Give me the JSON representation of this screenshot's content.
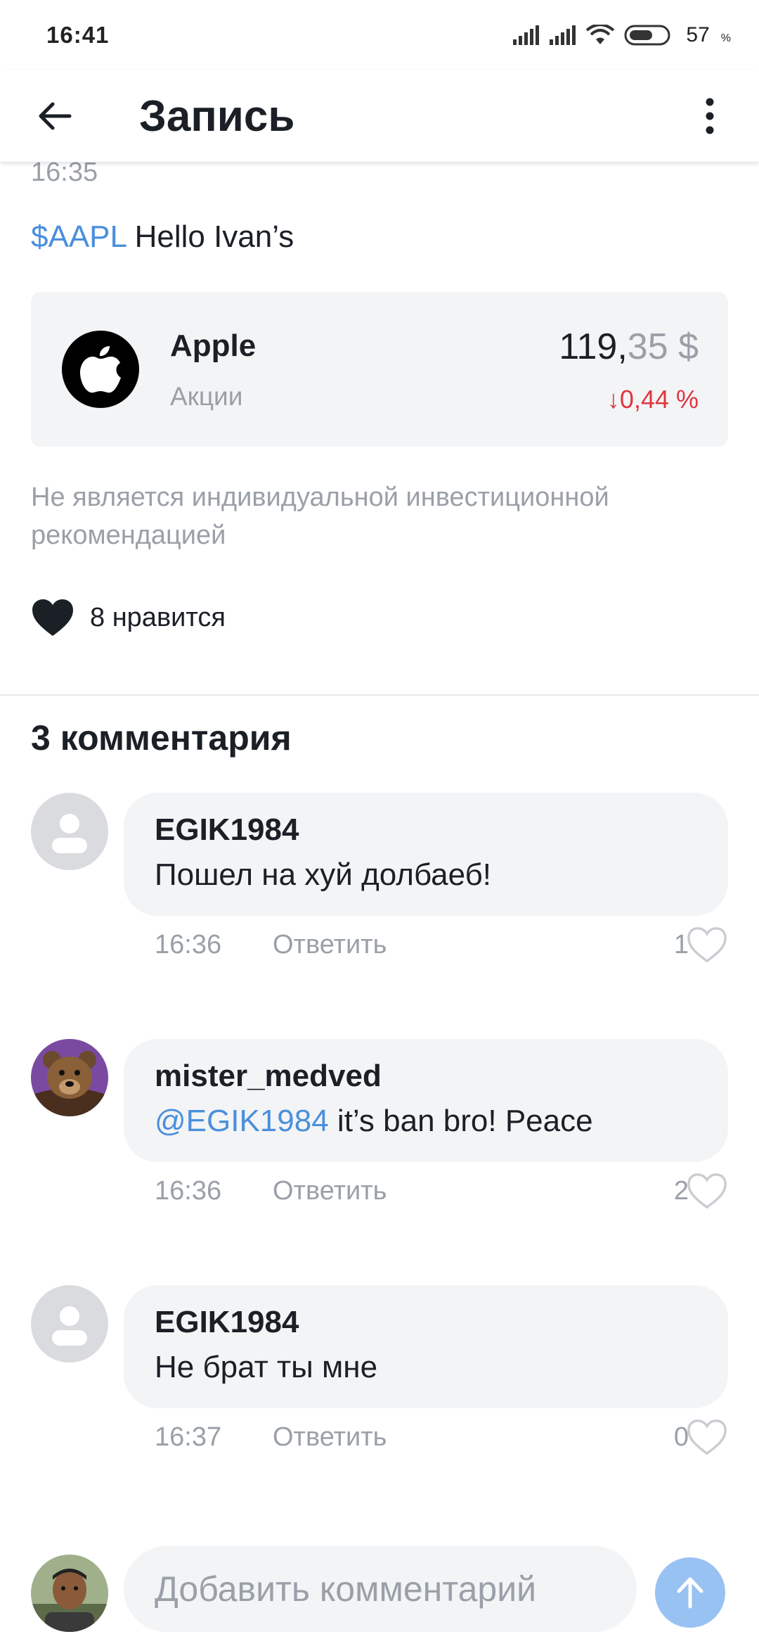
{
  "status_bar": {
    "time": "16:41",
    "battery_level": "57",
    "battery_unit": "%"
  },
  "app_bar": {
    "title": "Запись"
  },
  "post": {
    "time": "16:35",
    "ticker": "$AAPL",
    "text": " Hello Ivan’s",
    "stock": {
      "name": "Apple",
      "type": "Акции",
      "price_int": "119,",
      "price_dec": "35 $",
      "change": "↓0,44 %"
    },
    "disclaimer": "Не является индивидуальной инвестиционной рекомендацией",
    "likes": "8 нравится"
  },
  "comments_header": "3 комментария",
  "comments": [
    {
      "author": "EGIK1984",
      "mention": "",
      "text": "Пошел на хуй долбаеб!",
      "time": "16:36",
      "reply_label": "Ответить",
      "likes": "1"
    },
    {
      "author": "mister_medved",
      "mention": "@EGIK1984",
      "text": " it’s ban bro! Peace",
      "time": "16:36",
      "reply_label": "Ответить",
      "likes": "2"
    },
    {
      "author": "EGIK1984",
      "mention": "",
      "text": "Не брат ты мне",
      "time": "16:37",
      "reply_label": "Ответить",
      "likes": "0"
    }
  ],
  "composer": {
    "placeholder": "Добавить комментарий"
  },
  "colors": {
    "accent_link": "#4a8fdc",
    "negative_change": "#e0353f",
    "send_button": "#98c2f2"
  }
}
